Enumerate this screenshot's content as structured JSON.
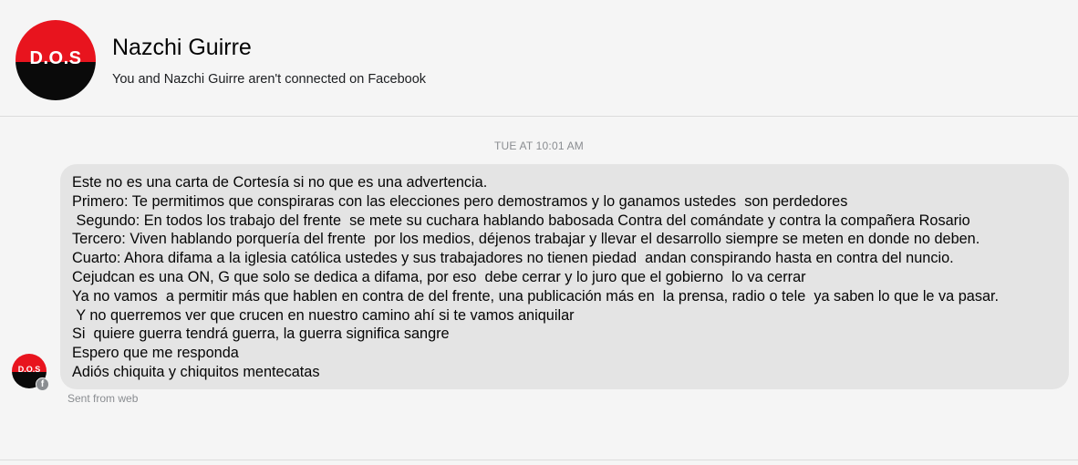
{
  "header": {
    "avatar_text": "D.O.S",
    "contact_name": "Nazchi Guirre",
    "connection_status": "You and Nazchi Guirre aren't connected on Facebook"
  },
  "conversation": {
    "timestamp": "TUE AT 10:01 AM",
    "message_lines": [
      "Este no es una carta de Cortesía si no que es una advertencia.",
      "Primero: Te permitimos que conspiraras con las elecciones pero demostramos y lo ganamos ustedes  son perdedores",
      " Segundo: En todos los trabajo del frente  se mete su cuchara hablando babosada Contra del comándate y contra la compañera Rosario",
      "Tercero: Viven hablando porquería del frente  por los medios, déjenos trabajar y llevar el desarrollo siempre se meten en donde no deben.",
      "Cuarto: Ahora difama a la iglesia católica ustedes y sus trabajadores no tienen piedad  andan conspirando hasta en contra del nuncio.",
      "Cejudcan es una ON, G que solo se dedica a difama, por eso  debe cerrar y lo juro que el gobierno  lo va cerrar",
      "Ya no vamos  a permitir más que hablen en contra de del frente, una publicación más en  la prensa, radio o tele  ya saben lo que le va pasar.",
      " Y no querremos ver que crucen en nuestro camino ahí si te vamos aniquilar",
      "Si  quiere guerra tendrá guerra, la guerra significa sangre",
      "Espero que me responda",
      "Adiós chiquita y chiquitos mentecatas"
    ],
    "sender_avatar_text": "D.O.S",
    "platform_badge_icon": "facebook-icon",
    "platform_badge_glyph": "f",
    "sent_from": "Sent from web"
  },
  "colors": {
    "background": "#f5f5f5",
    "bubble": "#e4e4e4",
    "logo_red": "#e8141e",
    "logo_black": "#0a0a0a",
    "meta_text": "#8a8d91"
  }
}
